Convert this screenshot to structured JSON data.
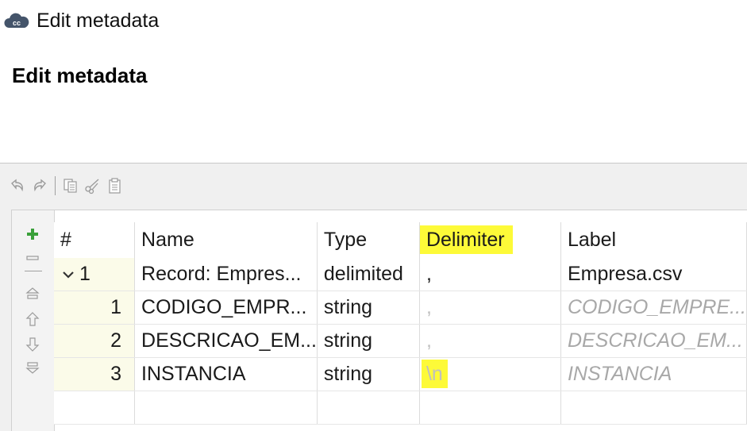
{
  "window": {
    "title": "Edit metadata",
    "icon": "cloud-cc-icon"
  },
  "page": {
    "title": "Edit metadata"
  },
  "toolbar": {
    "buttons": [
      "undo-icon",
      "redo-icon",
      "copy-icon",
      "cut-icon",
      "paste-icon"
    ]
  },
  "side_tools": [
    "add-icon",
    "remove-icon",
    "move-top-icon",
    "move-up-icon",
    "move-down-icon",
    "move-bottom-icon"
  ],
  "table": {
    "headers": {
      "num": "#",
      "name": "Name",
      "type": "Type",
      "delimiter": "Delimiter",
      "label": "Label"
    },
    "record": {
      "num": "1",
      "name": "Record: Empres...",
      "type": "delimited",
      "delimiter": ",",
      "label": "Empresa.csv"
    },
    "rows": [
      {
        "num": "1",
        "name": "CODIGO_EMPR...",
        "type": "string",
        "delimiter": ",",
        "label": "CODIGO_EMPRE..."
      },
      {
        "num": "2",
        "name": "DESCRICAO_EM...",
        "type": "string",
        "delimiter": ",",
        "label": "DESCRICAO_EM..."
      },
      {
        "num": "3",
        "name": "INSTANCIA",
        "type": "string",
        "delimiter": "\\n",
        "label": "INSTANCIA"
      }
    ]
  },
  "colors": {
    "highlight": "#fdfa38",
    "row_num_bg": "#fbfbe9",
    "add_green": "#3aa03a"
  }
}
